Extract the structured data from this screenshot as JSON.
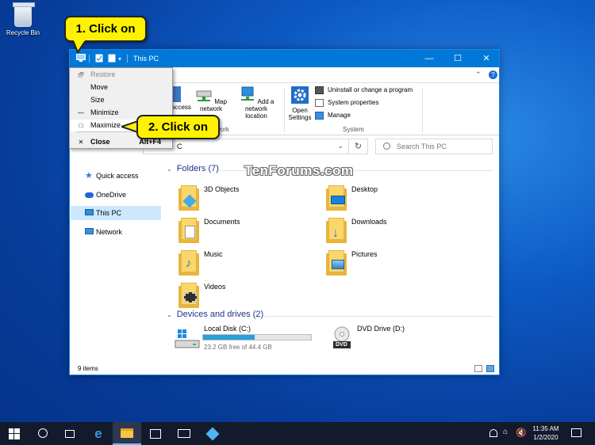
{
  "desktop": {
    "recycle_bin_label": "Recycle Bin"
  },
  "window": {
    "title": "This PC",
    "controls": {
      "minimize": "—",
      "maximize": "☐",
      "close": "✕"
    },
    "ribbon": {
      "access_label": "access",
      "map_network_label": "Map network",
      "add_network_location_label": [
        "Add a network",
        "location"
      ],
      "open_settings_label": [
        "Open",
        "Settings"
      ],
      "network_group_partial": "work",
      "uninstall_label": "Uninstall or change a program",
      "system_properties_label": "System properties",
      "manage_label": "Manage",
      "system_group_label": "System"
    },
    "address_fragment": "C",
    "search_placeholder": "Search This PC",
    "nav": [
      {
        "label": "Quick access",
        "icon": "star-icon"
      },
      {
        "label": "OneDrive",
        "icon": "cloud-icon"
      },
      {
        "label": "This PC",
        "icon": "computer-icon",
        "selected": true
      },
      {
        "label": "Network",
        "icon": "network-icon"
      }
    ],
    "folders_header": "Folders (7)",
    "folders": [
      {
        "label": "3D Objects"
      },
      {
        "label": "Desktop"
      },
      {
        "label": "Documents"
      },
      {
        "label": "Downloads"
      },
      {
        "label": "Music"
      },
      {
        "label": "Pictures"
      },
      {
        "label": "Videos"
      }
    ],
    "drives_header": "Devices and drives (2)",
    "drives": [
      {
        "label": "Local Disk (C:)",
        "free_text": "23.2 GB free of 44.4 GB",
        "used_fraction": 0.48
      },
      {
        "label": "DVD Drive (D:)",
        "badge": "DVD"
      }
    ],
    "status_text": "9 items"
  },
  "system_menu": {
    "items": [
      {
        "glyph": "🗗",
        "label": "Restore",
        "disabled": true
      },
      {
        "glyph": "",
        "label": "Move"
      },
      {
        "glyph": "",
        "label": "Size"
      },
      {
        "glyph": "—",
        "label": "Minimize"
      },
      {
        "glyph": "□",
        "label": "Maximize",
        "highlighted": true
      },
      {
        "glyph": "✕",
        "label": "Close",
        "shortcut": "Alt+F4",
        "bold": true
      }
    ]
  },
  "callouts": {
    "step1": "1. Click on",
    "step2": "2. Click on"
  },
  "watermark": "TenForums.com",
  "taskbar": {
    "time": "11:35 AM",
    "date": "1/2/2020"
  },
  "colors": {
    "titlebar": "#0078d7",
    "callout": "#fff200",
    "selected_nav": "#cce8ff",
    "drive_bar": "#26a0da"
  }
}
